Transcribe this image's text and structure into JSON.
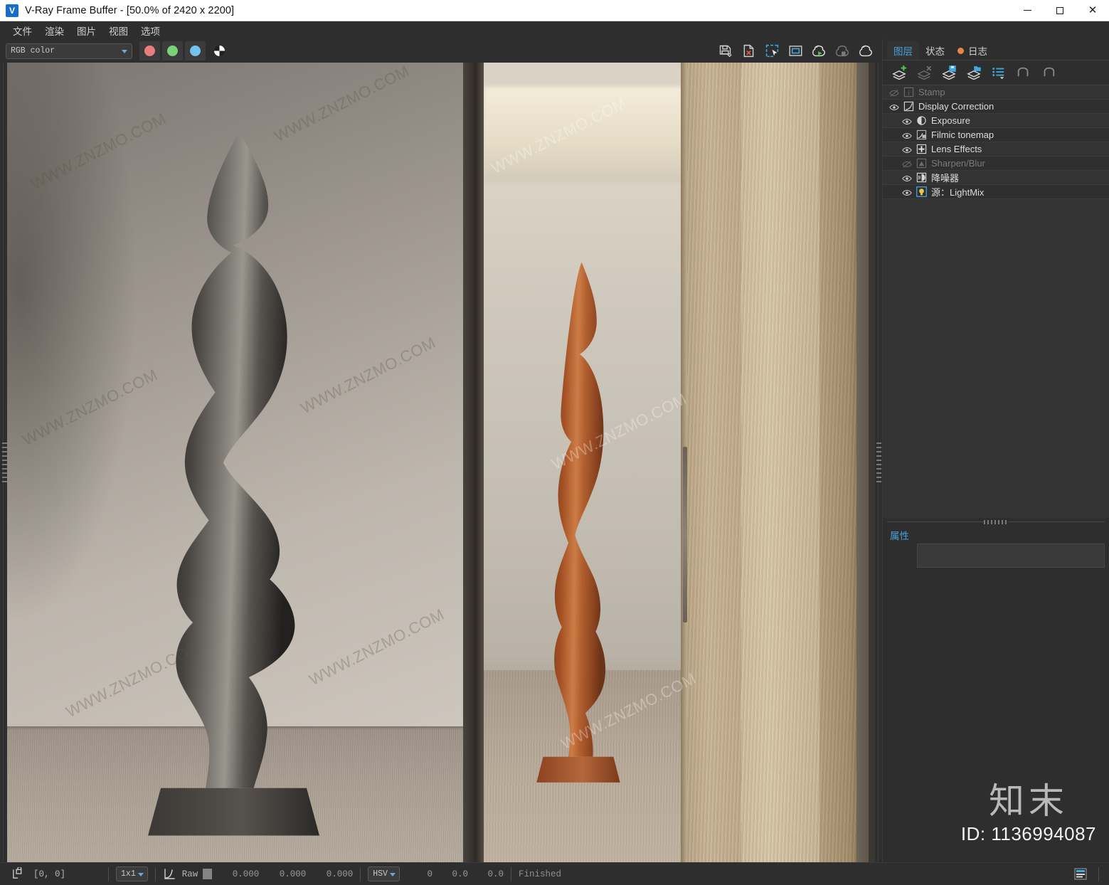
{
  "window": {
    "title": "V-Ray Frame Buffer - [50.0% of 2420 x 2200]",
    "app_icon": "vray-logo-icon",
    "controls": {
      "minimize": "minimize-icon",
      "maximize": "maximize-icon",
      "close": "close-icon"
    }
  },
  "menubar": {
    "items": [
      {
        "label": "文件"
      },
      {
        "label": "渲染"
      },
      {
        "label": "图片"
      },
      {
        "label": "视图"
      },
      {
        "label": "选项"
      }
    ]
  },
  "viewtoolbar": {
    "channel": {
      "value": "RGB color",
      "placeholder": "RGB color"
    },
    "channel_buttons": [
      {
        "name": "red-channel-button",
        "color": "#e87d7d"
      },
      {
        "name": "green-channel-button",
        "color": "#7ad37a"
      },
      {
        "name": "blue-channel-button",
        "color": "#74c4ef"
      }
    ],
    "alpha_button": {
      "name": "alpha-channel-button"
    },
    "right_icons": [
      {
        "name": "save-image-icon",
        "title": "Save image"
      },
      {
        "name": "clear-image-icon",
        "title": "Clear image"
      },
      {
        "name": "region-select-icon",
        "title": "Render region"
      },
      {
        "name": "fit-view-icon",
        "title": "Fit to window"
      },
      {
        "name": "render-start-icon",
        "title": "Start render"
      },
      {
        "name": "render-stop-icon",
        "title": "Stop render"
      },
      {
        "name": "render-last-icon",
        "title": "Render last"
      }
    ]
  },
  "dock": {
    "tabs": [
      {
        "label": "图层",
        "active": true,
        "dot": false
      },
      {
        "label": "状态",
        "active": false,
        "dot": false
      },
      {
        "label": "日志",
        "active": false,
        "dot": true,
        "dot_color": "#e8864a"
      }
    ],
    "layer_toolbar": [
      {
        "name": "add-layer-icon"
      },
      {
        "name": "delete-layer-icon"
      },
      {
        "name": "save-layer-icon"
      },
      {
        "name": "load-layer-icon"
      },
      {
        "name": "layer-list-menu-icon"
      },
      {
        "name": "undo-icon"
      },
      {
        "name": "redo-icon"
      }
    ],
    "layers": [
      {
        "label": "Stamp",
        "icon": "stamp-icon",
        "visible": false,
        "enabled": false,
        "indent": false
      },
      {
        "label": "Display Correction",
        "icon": "curve-icon",
        "visible": true,
        "enabled": true,
        "indent": false
      },
      {
        "label": "Exposure",
        "icon": "exposure-icon",
        "visible": true,
        "enabled": true,
        "indent": true
      },
      {
        "label": "Filmic tonemap",
        "icon": "filmic-tonemap-icon",
        "visible": true,
        "enabled": true,
        "indent": true
      },
      {
        "label": "Lens Effects",
        "icon": "lens-effects-icon",
        "visible": true,
        "enabled": true,
        "indent": true
      },
      {
        "label": "Sharpen/Blur",
        "icon": "sharpen-blur-icon",
        "visible": false,
        "enabled": false,
        "indent": true
      },
      {
        "label": "降噪器",
        "icon": "denoiser-icon",
        "visible": true,
        "enabled": true,
        "indent": true
      },
      {
        "label": "源：LightMix",
        "icon": "lightmix-source-icon",
        "visible": true,
        "enabled": true,
        "indent": true
      }
    ],
    "properties": {
      "tab_label": "属性"
    }
  },
  "statusbar": {
    "pixel_lock_icon": "pixel-lock-icon",
    "coords": "[0,  0]",
    "sample_size": {
      "value": "1x1"
    },
    "curve_icon": "color-curve-icon",
    "raw_label": "Raw",
    "raw_swatch": "#848484",
    "raw_values": [
      "0.000",
      "0.000",
      "0.000"
    ],
    "color_mode": {
      "value": "HSV"
    },
    "hsv_values": [
      "0",
      "0.0",
      "0.0"
    ],
    "status_text": "Finished",
    "layout_icon": "panel-layout-icon"
  },
  "render": {
    "watermarks": [
      "WWW.ZNZMO.COM",
      "WWW.ZNZMO.COM",
      "WWW.ZNZMO.COM",
      "WWW.ZNZMO.COM",
      "WWW.ZNZMO.COM",
      "WWW.ZNZMO.COM",
      "WWW.ZNZMO.COM",
      "WWW.ZNZMO.COM",
      "WWW.ZNZMO.COM"
    ],
    "description": "Interior render: dark bronze abstract sculpture in foreground room, copper sculpture visible through open doorway, light oak wood doors"
  },
  "brand_watermark": {
    "name": "知末",
    "id": "ID: 1136994087"
  }
}
